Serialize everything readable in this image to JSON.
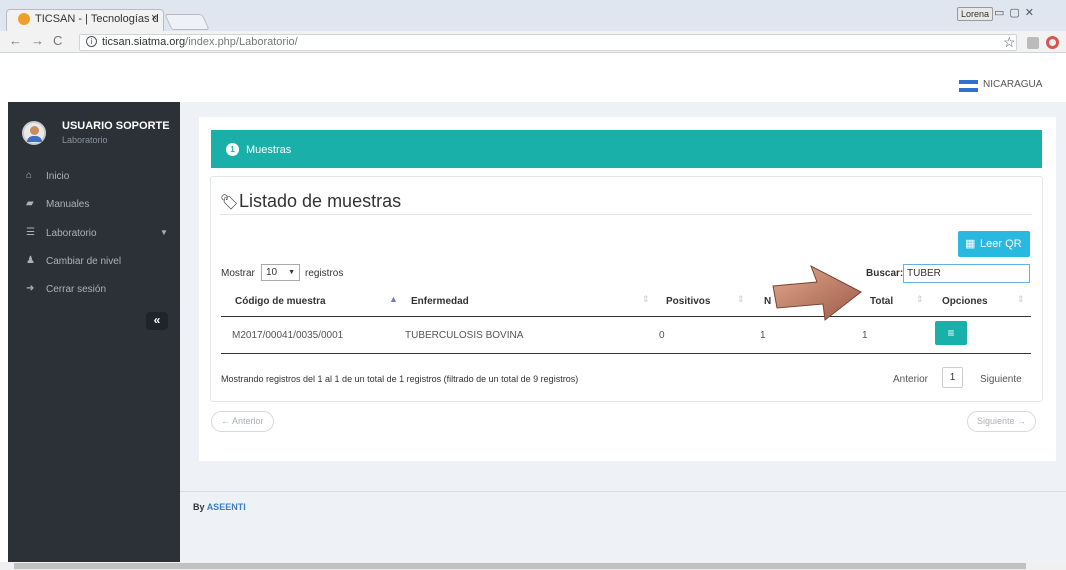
{
  "browser": {
    "tab_title": "TICSAN - | Tecnologías d",
    "tab_close": "×",
    "user_chip": "Lorena",
    "url_host": "ticsan.siatma.org",
    "url_path": "/index.php/Laboratorio/"
  },
  "topbar": {
    "country": "NICARAGUA"
  },
  "sidebar": {
    "user_name": "USUARIO SOPORTE",
    "user_role": "Laboratorio",
    "items": [
      {
        "label": "Inicio",
        "icon": "home-icon"
      },
      {
        "label": "Manuales",
        "icon": "book-icon"
      },
      {
        "label": "Laboratorio",
        "icon": "list-icon"
      },
      {
        "label": "Cambiar de nivel",
        "icon": "users-icon"
      },
      {
        "label": "Cerrar sesión",
        "icon": "logout-icon"
      }
    ],
    "collapse_label": "«"
  },
  "steps": {
    "number": "1",
    "label": "Muestras"
  },
  "list": {
    "title": "Listado de muestras",
    "qr_button": "Leer QR",
    "show_prefix": "Mostrar",
    "show_value": "10",
    "show_suffix": "registros",
    "search_label": "Buscar:",
    "search_value": "TUBER",
    "columns": [
      "Código de muestra",
      "Enfermedad",
      "Positivos",
      "N",
      "Total",
      "Opciones"
    ],
    "rows": [
      {
        "codigo": "M2017/00041/0035/0001",
        "enfermedad": "TUBERCULOSIS BOVINA",
        "positivos": "0",
        "n": "1",
        "total": "1"
      }
    ],
    "info": "Mostrando registros del 1 al 1 de un total de 1 registros (filtrado de un total de 9 registros)",
    "pagination": {
      "prev": "Anterior",
      "page": "1",
      "next": "Siguiente"
    }
  },
  "pager": {
    "prev": "← Anterior",
    "next": "Siguiente →"
  },
  "footer": {
    "prefix": "By",
    "brand": "ASEENTI"
  },
  "colors": {
    "accent": "#18b0a9",
    "button": "#29b8e0",
    "sidebar": "#2b3137",
    "arrow": "#b9735f"
  }
}
